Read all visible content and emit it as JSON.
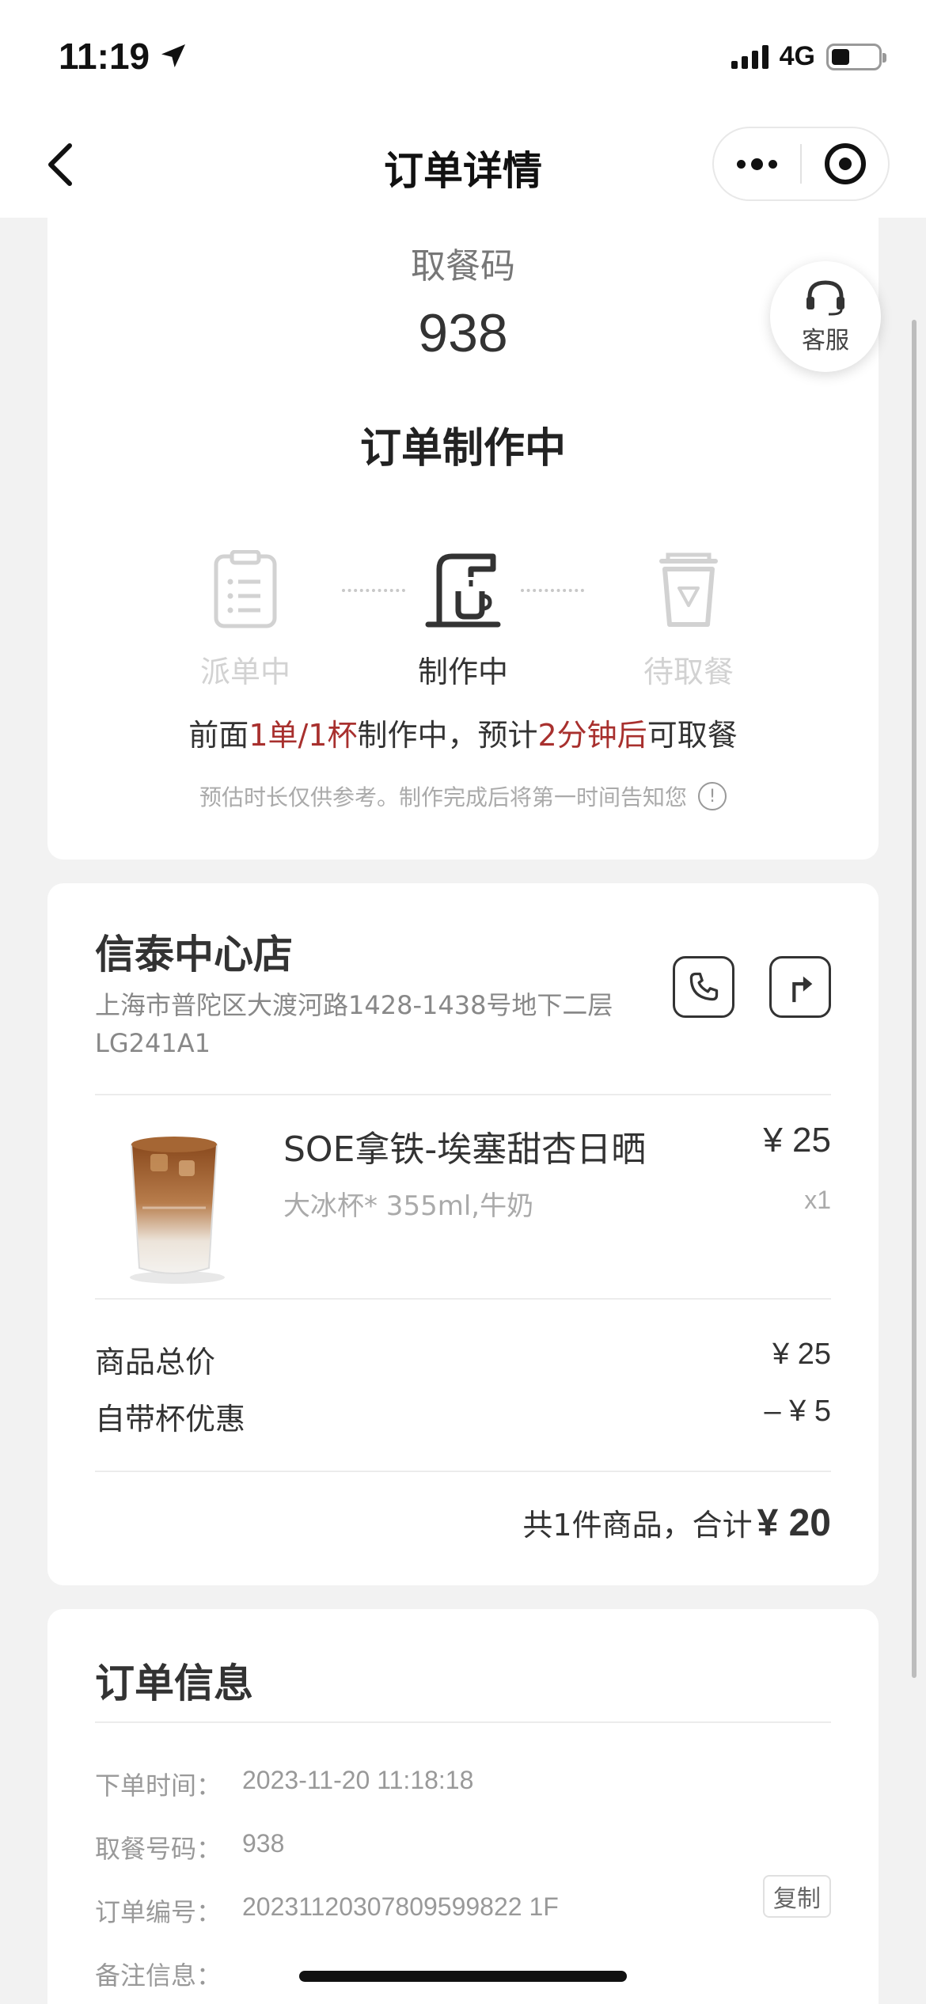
{
  "status_bar": {
    "time": "11:19",
    "network": "4G"
  },
  "nav": {
    "title": "订单详情"
  },
  "order": {
    "pickup_label": "取餐码",
    "pickup_code": "938",
    "status": "订单制作中",
    "steps": [
      {
        "label": "派单中",
        "icon": "clipboard-icon",
        "state": "done"
      },
      {
        "label": "制作中",
        "icon": "coffee-machine-icon",
        "state": "active"
      },
      {
        "label": "待取餐",
        "icon": "cup-icon",
        "state": "pending"
      }
    ],
    "queue_prefix": "前面",
    "queue_count": "1单/1杯",
    "queue_mid": "制作中，预计",
    "queue_time": "2分钟后",
    "queue_suffix": "可取餐",
    "estimate_note": "预估时长仅供参考。制作完成后将第一时间告知您",
    "accent_color": "#a8302e"
  },
  "customer_service": {
    "label": "客服"
  },
  "store": {
    "name": "信泰中心店",
    "address": "上海市普陀区大渡河路1428-1438号地下二层LG241A1"
  },
  "product": {
    "name": "SOE拿铁-埃塞甜杏日晒",
    "spec": "大冰杯* 355ml,牛奶",
    "price": "¥ 25",
    "qty": "x1"
  },
  "summary": {
    "subtotal_label": "商品总价",
    "subtotal_value": "¥ 25",
    "discount_label": "自带杯优惠",
    "discount_value": "–  ¥ 5",
    "total_prefix": "共1件商品，合计",
    "total_value": "¥ 20"
  },
  "order_info": {
    "title": "订单信息",
    "rows": [
      {
        "label": "下单时间：",
        "value": "2023-11-20 11:18:18"
      },
      {
        "label": "取餐号码：",
        "value": "938"
      },
      {
        "label": "订单编号：",
        "value": "20231120307809599822 1F"
      },
      {
        "label": "备注信息：",
        "value": ""
      }
    ],
    "copy_label": "复制"
  }
}
